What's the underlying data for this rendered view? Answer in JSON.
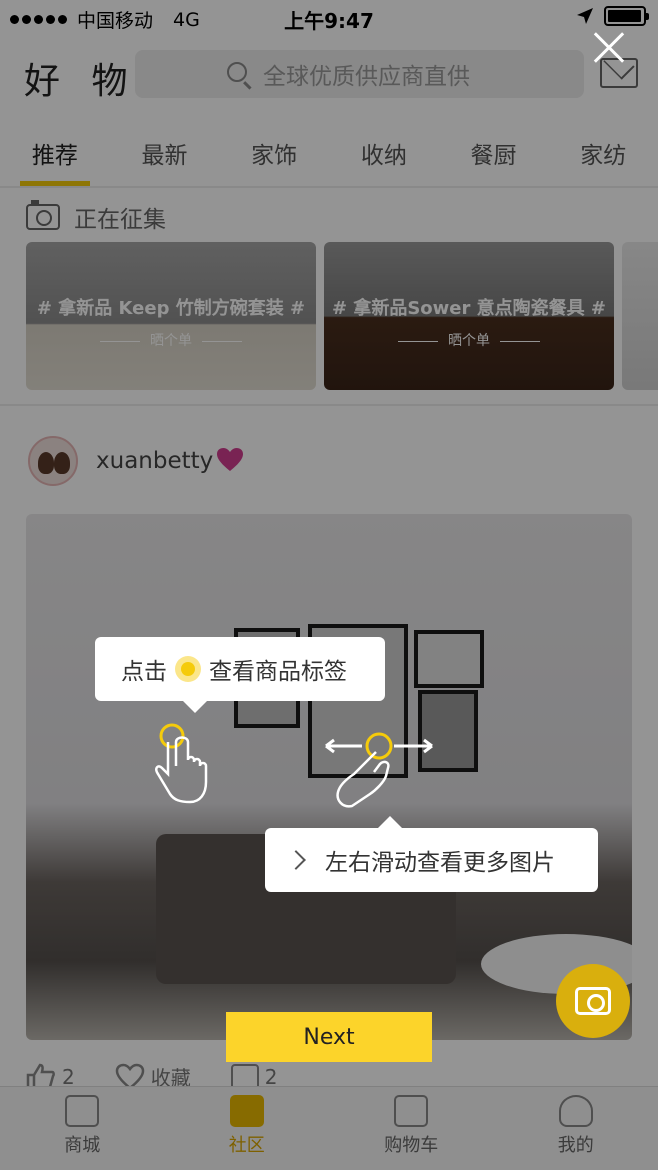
{
  "status": {
    "carrier": "中国移动",
    "network": "4G",
    "time": "上午9:47"
  },
  "header": {
    "brand": "好 物",
    "search_placeholder": "全球优质供应商直供"
  },
  "tabs": [
    "推荐",
    "最新",
    "家饰",
    "收纳",
    "餐厨",
    "家纺"
  ],
  "collecting": {
    "title": "正在征集",
    "cards": [
      {
        "title": "# 拿新品 Keep 竹制方碗套装 #",
        "sub": "晒个单"
      },
      {
        "title": "# 拿新品Sower 意点陶瓷餐具 #",
        "sub": "晒个单"
      }
    ]
  },
  "post": {
    "username": "xuanbetty",
    "likes": "2",
    "favorite_label": "收藏",
    "comments": "2"
  },
  "guide": {
    "tip_tap_prefix": "点击",
    "tip_tap_suffix": "查看商品标签",
    "tip_swipe": "左右滑动查看更多图片",
    "next_label": "Next"
  },
  "bottom_nav": [
    "商城",
    "社区",
    "购物车",
    "我的"
  ],
  "colors": {
    "accent": "#f5cb0b",
    "next_button": "#fcd42a"
  }
}
